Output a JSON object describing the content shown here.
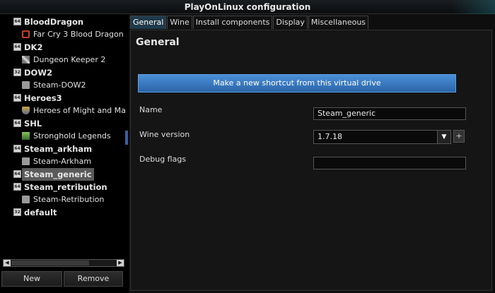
{
  "window": {
    "title": "PlayOnLinux configuration"
  },
  "sidebar": {
    "items": [
      {
        "label": "BloodDragon",
        "kind": "category",
        "badge": "64"
      },
      {
        "label": "Far Cry 3 Blood Dragon",
        "kind": "child",
        "icon": "red-square-icon"
      },
      {
        "label": "DK2",
        "kind": "category",
        "badge": "64"
      },
      {
        "label": "Dungeon Keeper 2",
        "kind": "child",
        "icon": "sword-icon"
      },
      {
        "label": "DOW2",
        "kind": "category",
        "badge": "32"
      },
      {
        "label": "Steam-DOW2",
        "kind": "child",
        "icon": "steam-icon"
      },
      {
        "label": "Heroes3",
        "kind": "category",
        "badge": "64"
      },
      {
        "label": "Heroes of Might and Magic",
        "kind": "child",
        "icon": "shield-icon"
      },
      {
        "label": "SHL",
        "kind": "category",
        "badge": "64"
      },
      {
        "label": "Stronghold Legends",
        "kind": "child",
        "icon": "map-icon"
      },
      {
        "label": "Steam_arkham",
        "kind": "category",
        "badge": "64"
      },
      {
        "label": "Steam-Arkham",
        "kind": "child",
        "icon": "steam-icon"
      },
      {
        "label": "Steam_generic",
        "kind": "category",
        "badge": "64",
        "selected": true
      },
      {
        "label": "Steam_retribution",
        "kind": "category",
        "badge": "64"
      },
      {
        "label": "Steam-Retribution",
        "kind": "child",
        "icon": "steam-icon"
      },
      {
        "label": "default",
        "kind": "category",
        "badge": "32"
      }
    ],
    "new_label": "New",
    "remove_label": "Remove"
  },
  "tabs": [
    {
      "label": "General",
      "active": true
    },
    {
      "label": "Wine"
    },
    {
      "label": "Install components"
    },
    {
      "label": "Display"
    },
    {
      "label": "Miscellaneous"
    }
  ],
  "general": {
    "section_title": "General",
    "shortcut_button": "Make a new shortcut from this virtual drive",
    "name_label": "Name",
    "name_value": "Steam_generic",
    "wine_version_label": "Wine version",
    "wine_version_value": "1.7.18",
    "debug_flags_label": "Debug flags",
    "debug_flags_value": ""
  },
  "colors": {
    "accent": "#3a7fc8",
    "tab_active": "#1f3a4a",
    "background": "#000000"
  }
}
